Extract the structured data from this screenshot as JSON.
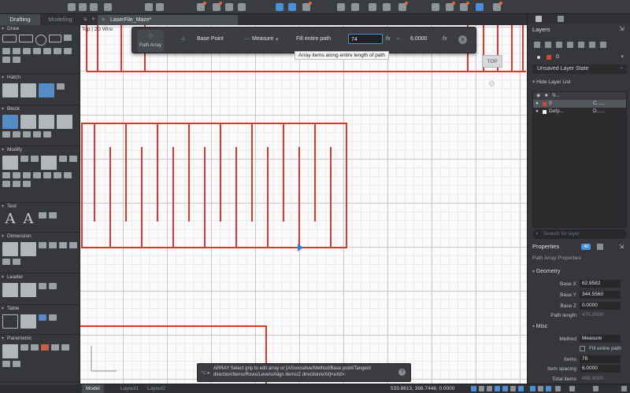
{
  "workspace_tabs": [
    "Drafting",
    "Modeling"
  ],
  "document": {
    "tab_label": "LaserFile_Maze*",
    "view_label": "Top | 2D Wire"
  },
  "palette": {
    "sections": [
      "Draw",
      "Hatch",
      "Block",
      "Modify",
      "Text",
      "Dimension",
      "Leader",
      "Table",
      "Parametric"
    ]
  },
  "context_bar": {
    "path_array_label": "Path Array",
    "base_point_label": "Base Point",
    "measure_label": "Measure",
    "fill_entire_path_label": "Fill entire path",
    "field_value": "74",
    "spacing_value": "6.0000",
    "fx_label": "fx",
    "tooltip": "Array items along entire length of path"
  },
  "viewcube": {
    "face_label": "TOP"
  },
  "command_line": {
    "prefix": "⌥ ▸",
    "text": "ARRAY Select grip to edit array or [ASsociative/Method/Base point/Tangent direction/Items/Rows/Levels/Align items/Z direction/eXit]<eXit>:",
    "help": "?"
  },
  "statusbar": {
    "tabs": [
      "Model",
      "Layout1",
      "Layout2"
    ],
    "coordinates": "533.8613, 398.7448, 0.0000"
  },
  "right_panel": {
    "tab_icons": [
      "layers-tab",
      "grid-tab"
    ],
    "layers_title": "Layers",
    "current_layer": "0",
    "layer_state": "Unsaved Layer State",
    "hide_layer_list": "Hide Layer List",
    "columns": [
      "N..."
    ],
    "layers": [
      {
        "name": "0",
        "extra": "C......",
        "color": "#d04a3a",
        "selected": true
      },
      {
        "name": "Defp...",
        "extra": "D......",
        "color": "#f0f0f0",
        "selected": false
      }
    ],
    "search_placeholder": "Search for layer",
    "properties_title": "Properties",
    "all_label": "All",
    "object_type": "Path Array Properties",
    "geometry_label": "Geometry",
    "geometry": [
      {
        "key": "Base X",
        "value": "62.9582"
      },
      {
        "key": "Base Y",
        "value": "344.5560"
      },
      {
        "key": "Base Z",
        "value": "0.0000"
      },
      {
        "key": "Path length",
        "value": "475.3500"
      }
    ],
    "misc_label": "Misc",
    "misc": [
      {
        "key": "Method",
        "value": "Measure"
      },
      {
        "key": "",
        "value": "Fill entire path"
      },
      {
        "key": "Items",
        "value": "78"
      },
      {
        "key": "Item spacing",
        "value": "6.0000"
      },
      {
        "key": "Total items",
        "value": "468.0000"
      }
    ]
  }
}
